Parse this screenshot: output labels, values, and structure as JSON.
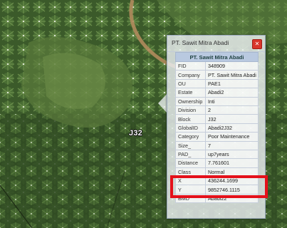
{
  "map": {
    "block_label": "J32"
  },
  "popup": {
    "title": "PT. Sawit Mitra Abadi",
    "close_icon": "close-icon",
    "table_header": "PT. Sawit Mitra Abadi",
    "rows": [
      {
        "key": "FID",
        "value": "348909"
      },
      {
        "key": "Company",
        "value": "PT. Sawit Mitra Abadi"
      },
      {
        "key": "OU",
        "value": "PAE1"
      },
      {
        "key": "Estate",
        "value": "Abadi2"
      },
      {
        "key": "Ownership",
        "value": "Inti"
      },
      {
        "key": "Division",
        "value": "2"
      },
      {
        "key": "Block",
        "value": "J32"
      },
      {
        "key": "GlobalID",
        "value": "Abadi2J32"
      },
      {
        "key": "Category",
        "value": "Poor Maintenance"
      },
      {
        "key": "Size_",
        "value": "7"
      },
      {
        "key": "PAD_",
        "value": "up7years"
      },
      {
        "key": "Distance",
        "value": "7.761601"
      },
      {
        "key": "Class",
        "value": "Normal"
      },
      {
        "key": "X",
        "value": "436244.1699"
      },
      {
        "key": "Y",
        "value": "9852746.1115"
      },
      {
        "key": "BMD",
        "value": "Abadi22"
      }
    ]
  },
  "colors": {
    "highlight": "#e4101a",
    "close_button": "#d9352b",
    "header_row": "#b9c9e0"
  }
}
